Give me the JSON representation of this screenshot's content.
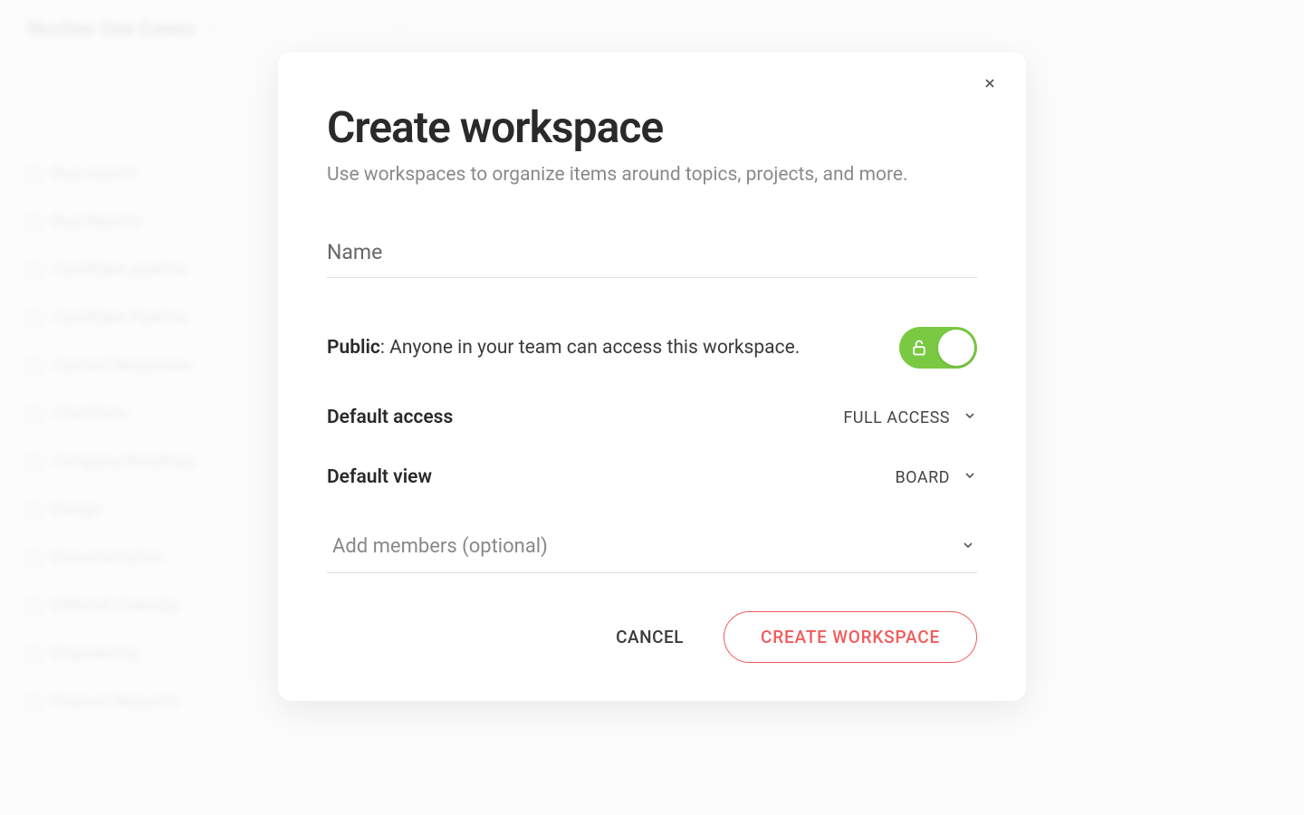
{
  "background": {
    "workspace_title": "Nuclino Use Cases",
    "sidebar_items": [
      "Bug reports",
      "Bug Reports",
      "Candidate pipeline",
      "Candidate Pipeline",
      "Canned Responses",
      "Checklists",
      "Company Roadmap",
      "Design",
      "Documentation",
      "Editorial Calendar",
      "Engineering",
      "Feature Requests"
    ]
  },
  "modal": {
    "title": "Create workspace",
    "subtitle": "Use workspaces to organize items around topics, projects, and more.",
    "name_placeholder": "Name",
    "public_label": "Public",
    "public_description": ": Anyone in your team can access this workspace.",
    "public_enabled": true,
    "default_access_label": "Default access",
    "default_access_value": "FULL ACCESS",
    "default_view_label": "Default view",
    "default_view_value": "BOARD",
    "add_members_placeholder": "Add members (optional)",
    "cancel_label": "CANCEL",
    "create_label": "CREATE WORKSPACE"
  }
}
